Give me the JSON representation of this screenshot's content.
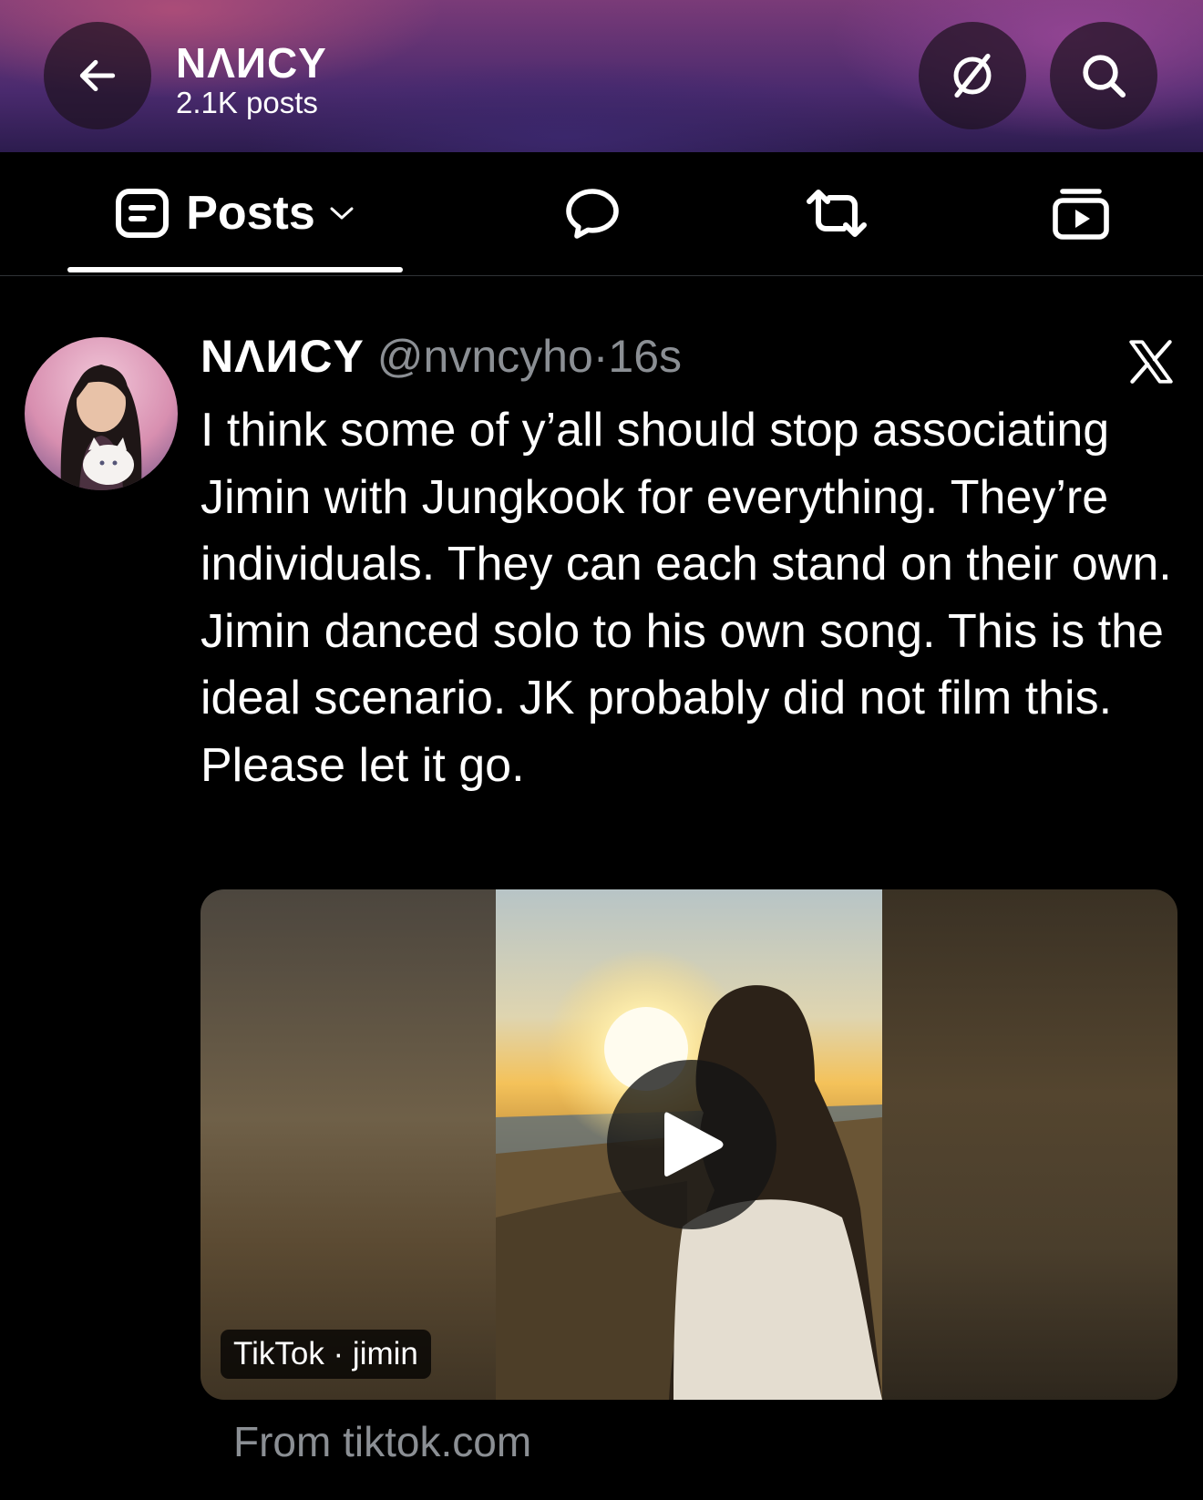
{
  "header": {
    "title": "NΛИCY",
    "post_count": "2.1K posts"
  },
  "tabs": {
    "posts_label": "Posts"
  },
  "post": {
    "author_name": "NΛИCY",
    "handle": "@nvncyho",
    "separator": "·",
    "time": "16s",
    "text": "I think some of y’all should stop associating Jimin with Jungkook for everything. They’re individuals. They can each stand on their own. Jimin danced solo to his own song. This is the ideal scenario. JK probably did not film this. Please let it go.",
    "media_badge": "TikTok · jimin",
    "source": "From tiktok.com"
  },
  "icons": {
    "back": "arrow-left-icon",
    "grok": "grok-icon",
    "search": "search-icon",
    "posts": "posts-icon",
    "replies": "reply-bubble-icon",
    "reposts": "repost-icon",
    "media": "media-play-icon",
    "x": "x-logo-icon",
    "play": "play-icon"
  },
  "colors": {
    "background": "#000000",
    "secondary_text": "#8b8f94",
    "primary_text": "#ffffff"
  }
}
